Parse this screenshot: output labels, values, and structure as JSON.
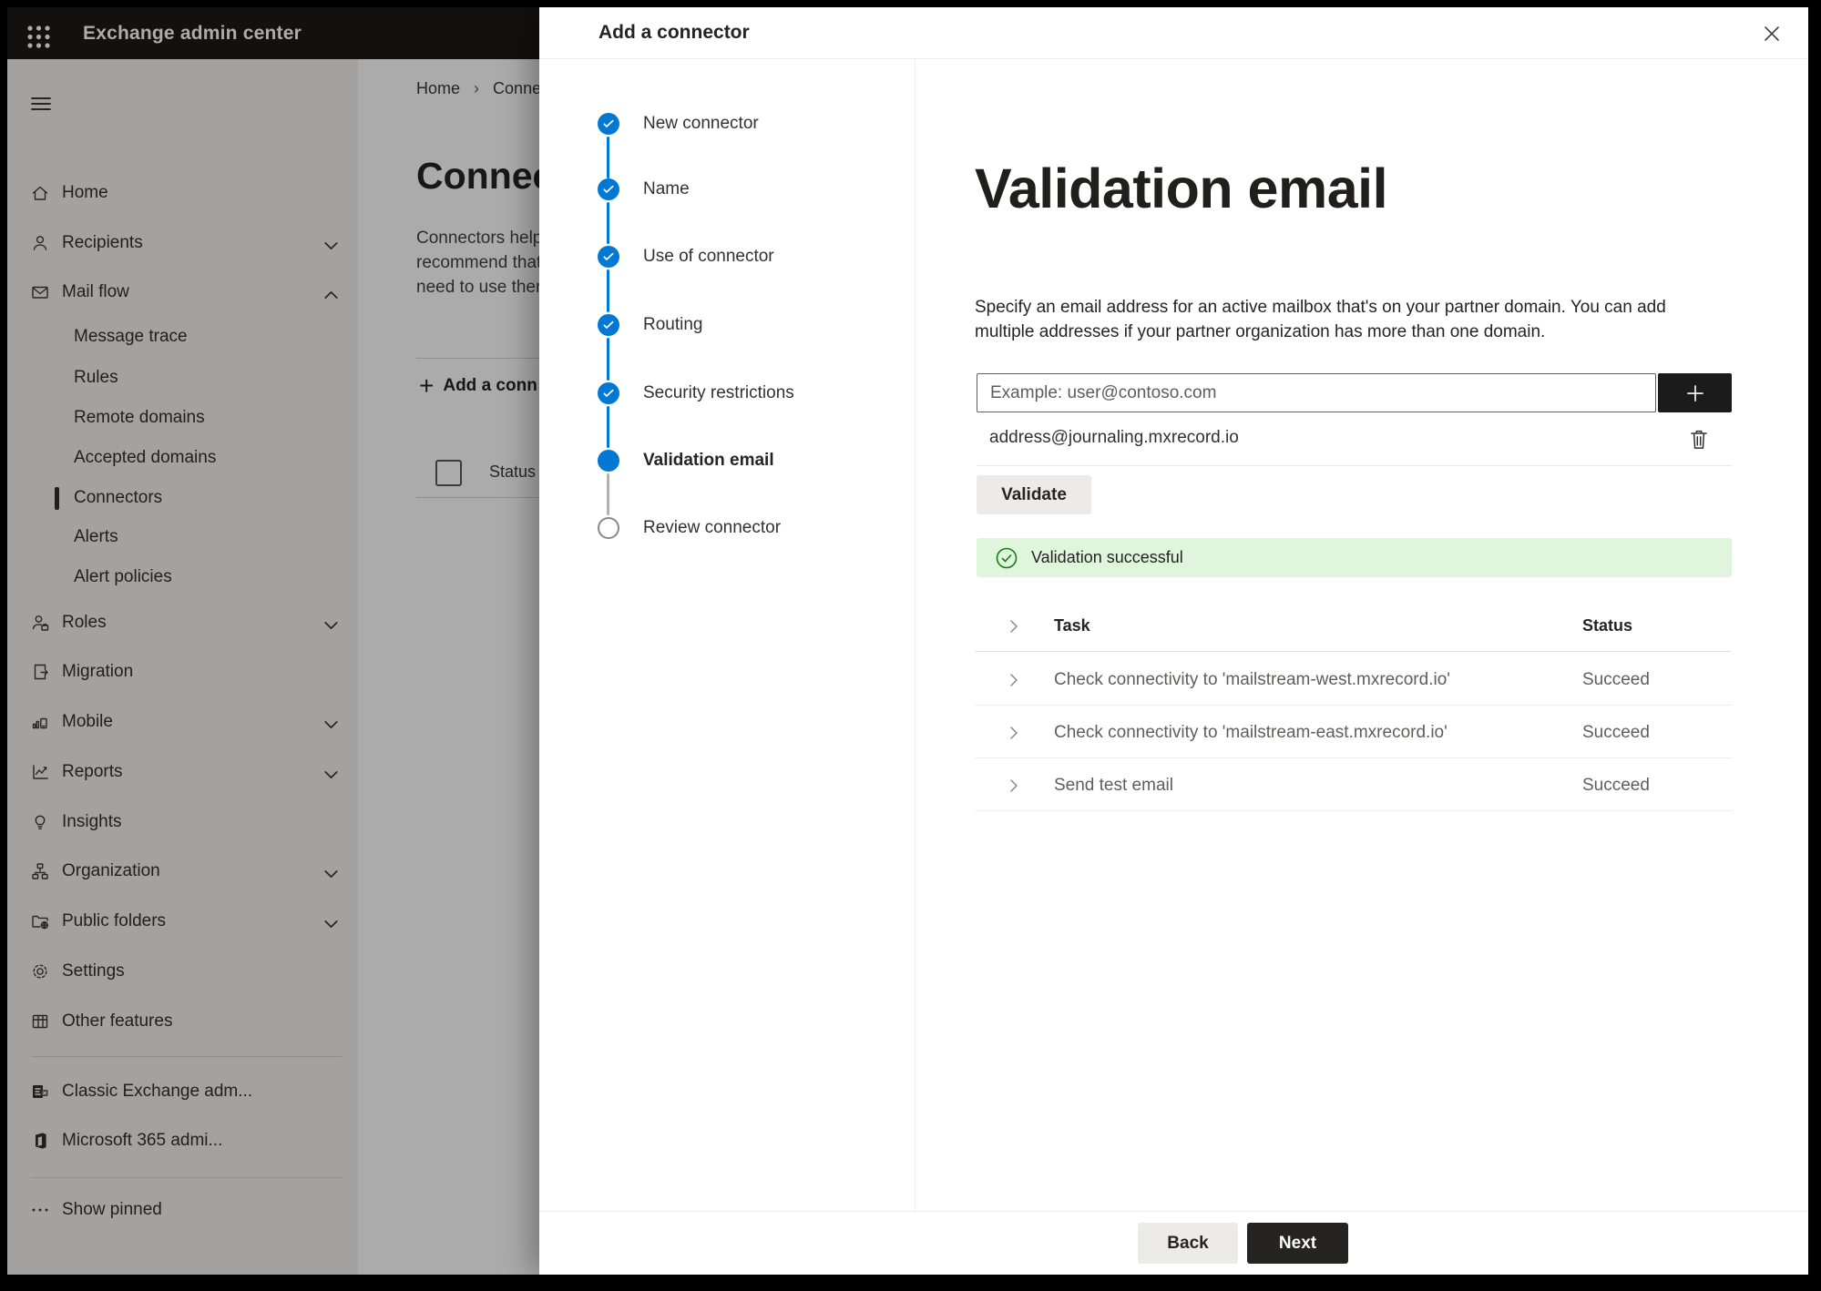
{
  "topbar": {
    "title": "Exchange admin center"
  },
  "sidebar": {
    "items": [
      {
        "label": "Home"
      },
      {
        "label": "Recipients"
      },
      {
        "label": "Mail flow"
      },
      {
        "label": "Message trace"
      },
      {
        "label": "Rules"
      },
      {
        "label": "Remote domains"
      },
      {
        "label": "Accepted domains"
      },
      {
        "label": "Connectors"
      },
      {
        "label": "Alerts"
      },
      {
        "label": "Alert policies"
      },
      {
        "label": "Roles"
      },
      {
        "label": "Migration"
      },
      {
        "label": "Mobile"
      },
      {
        "label": "Reports"
      },
      {
        "label": "Insights"
      },
      {
        "label": "Organization"
      },
      {
        "label": "Public folders"
      },
      {
        "label": "Settings"
      },
      {
        "label": "Other features"
      },
      {
        "label": "Classic Exchange adm..."
      },
      {
        "label": "Microsoft 365 admi..."
      },
      {
        "label": "Show pinned"
      }
    ]
  },
  "background_page": {
    "breadcrumb": [
      "Home",
      "Conne"
    ],
    "title": "Connec",
    "description_lines": [
      "Connectors help",
      "recommend that",
      "need to use ther"
    ],
    "add_button_label": "Add a conn",
    "column_header": "Status"
  },
  "dialog": {
    "title": "Add a connector",
    "steps": [
      {
        "label": "New connector",
        "state": "done"
      },
      {
        "label": "Name",
        "state": "done"
      },
      {
        "label": "Use of connector",
        "state": "done"
      },
      {
        "label": "Routing",
        "state": "done"
      },
      {
        "label": "Security restrictions",
        "state": "done"
      },
      {
        "label": "Validation email",
        "state": "current"
      },
      {
        "label": "Review connector",
        "state": "todo"
      }
    ],
    "content": {
      "heading": "Validation email",
      "description": "Specify an email address for an active mailbox that's on your partner domain. You can add multiple addresses if your partner organization has more than one domain.",
      "email_input_placeholder": "Example: user@contoso.com",
      "added_address": "address@journaling.mxrecord.io",
      "validate_button": "Validate",
      "validation_banner": "Validation successful",
      "results_table": {
        "task_header": "Task",
        "status_header": "Status",
        "rows": [
          {
            "task": "Check connectivity to 'mailstream-west.mxrecord.io'",
            "status": "Succeed"
          },
          {
            "task": "Check connectivity to 'mailstream-east.mxrecord.io'",
            "status": "Succeed"
          },
          {
            "task": "Send test email",
            "status": "Succeed"
          }
        ]
      }
    },
    "footer": {
      "back_button": "Back",
      "next_button": "Next"
    }
  },
  "colors": {
    "accent_blue": "#0078d4",
    "success_green": "#107c10",
    "banner_green_bg": "#dff6dd",
    "topbar_bg": "#1b1a19",
    "primary_button_bg": "#252423"
  }
}
